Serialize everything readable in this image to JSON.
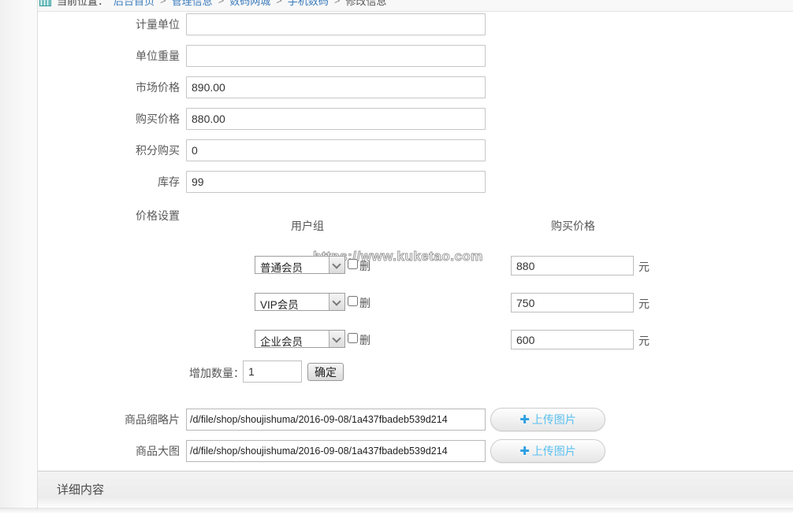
{
  "breadcrumb": {
    "prefix": "当前位置：",
    "separator": ">",
    "items": [
      {
        "label": "后台首页"
      },
      {
        "label": "管理信息"
      },
      {
        "label": "数码网城"
      },
      {
        "label": "手机数码"
      },
      {
        "label": "修改信息"
      }
    ]
  },
  "form": {
    "fields": [
      {
        "label": "计量单位",
        "value": ""
      },
      {
        "label": "单位重量",
        "value": ""
      },
      {
        "label": "市场价格",
        "value": "890.00"
      },
      {
        "label": "购买价格",
        "value": "880.00"
      },
      {
        "label": "积分购买",
        "value": "0"
      },
      {
        "label": "库存",
        "value": "99"
      }
    ],
    "price_settings": {
      "label": "价格设置",
      "columns": {
        "group": "用户组",
        "price": "购买价格"
      },
      "watermark": "https://www.kuketao.com",
      "rows": [
        {
          "group": "普通会员",
          "del_label": "删",
          "price": "880",
          "unit": "元"
        },
        {
          "group": "VIP会员",
          "del_label": "删",
          "price": "750",
          "unit": "元"
        },
        {
          "group": "企业会员",
          "del_label": "删",
          "price": "600",
          "unit": "元"
        }
      ],
      "add_row": {
        "label": "增加数量：",
        "value": "1",
        "button": "确定"
      }
    },
    "image_fields": [
      {
        "label": "商品缩略片",
        "value": "/d/file/shop/shoujishuma/2016-09-08/1a437fbadeb539d214",
        "button": "上传图片"
      },
      {
        "label": "商品大图",
        "value": "/d/file/shop/shoujishuma/2016-09-08/1a437fbadeb539d214",
        "button": "上传图片"
      }
    ]
  },
  "footer": {
    "section_title": "详细内容"
  },
  "colors": {
    "link": "#3a7bbd",
    "upload_text": "#5bc0f0",
    "plus_icon": "#2d9fe2",
    "watermark_gray": "#9b9b9b"
  }
}
